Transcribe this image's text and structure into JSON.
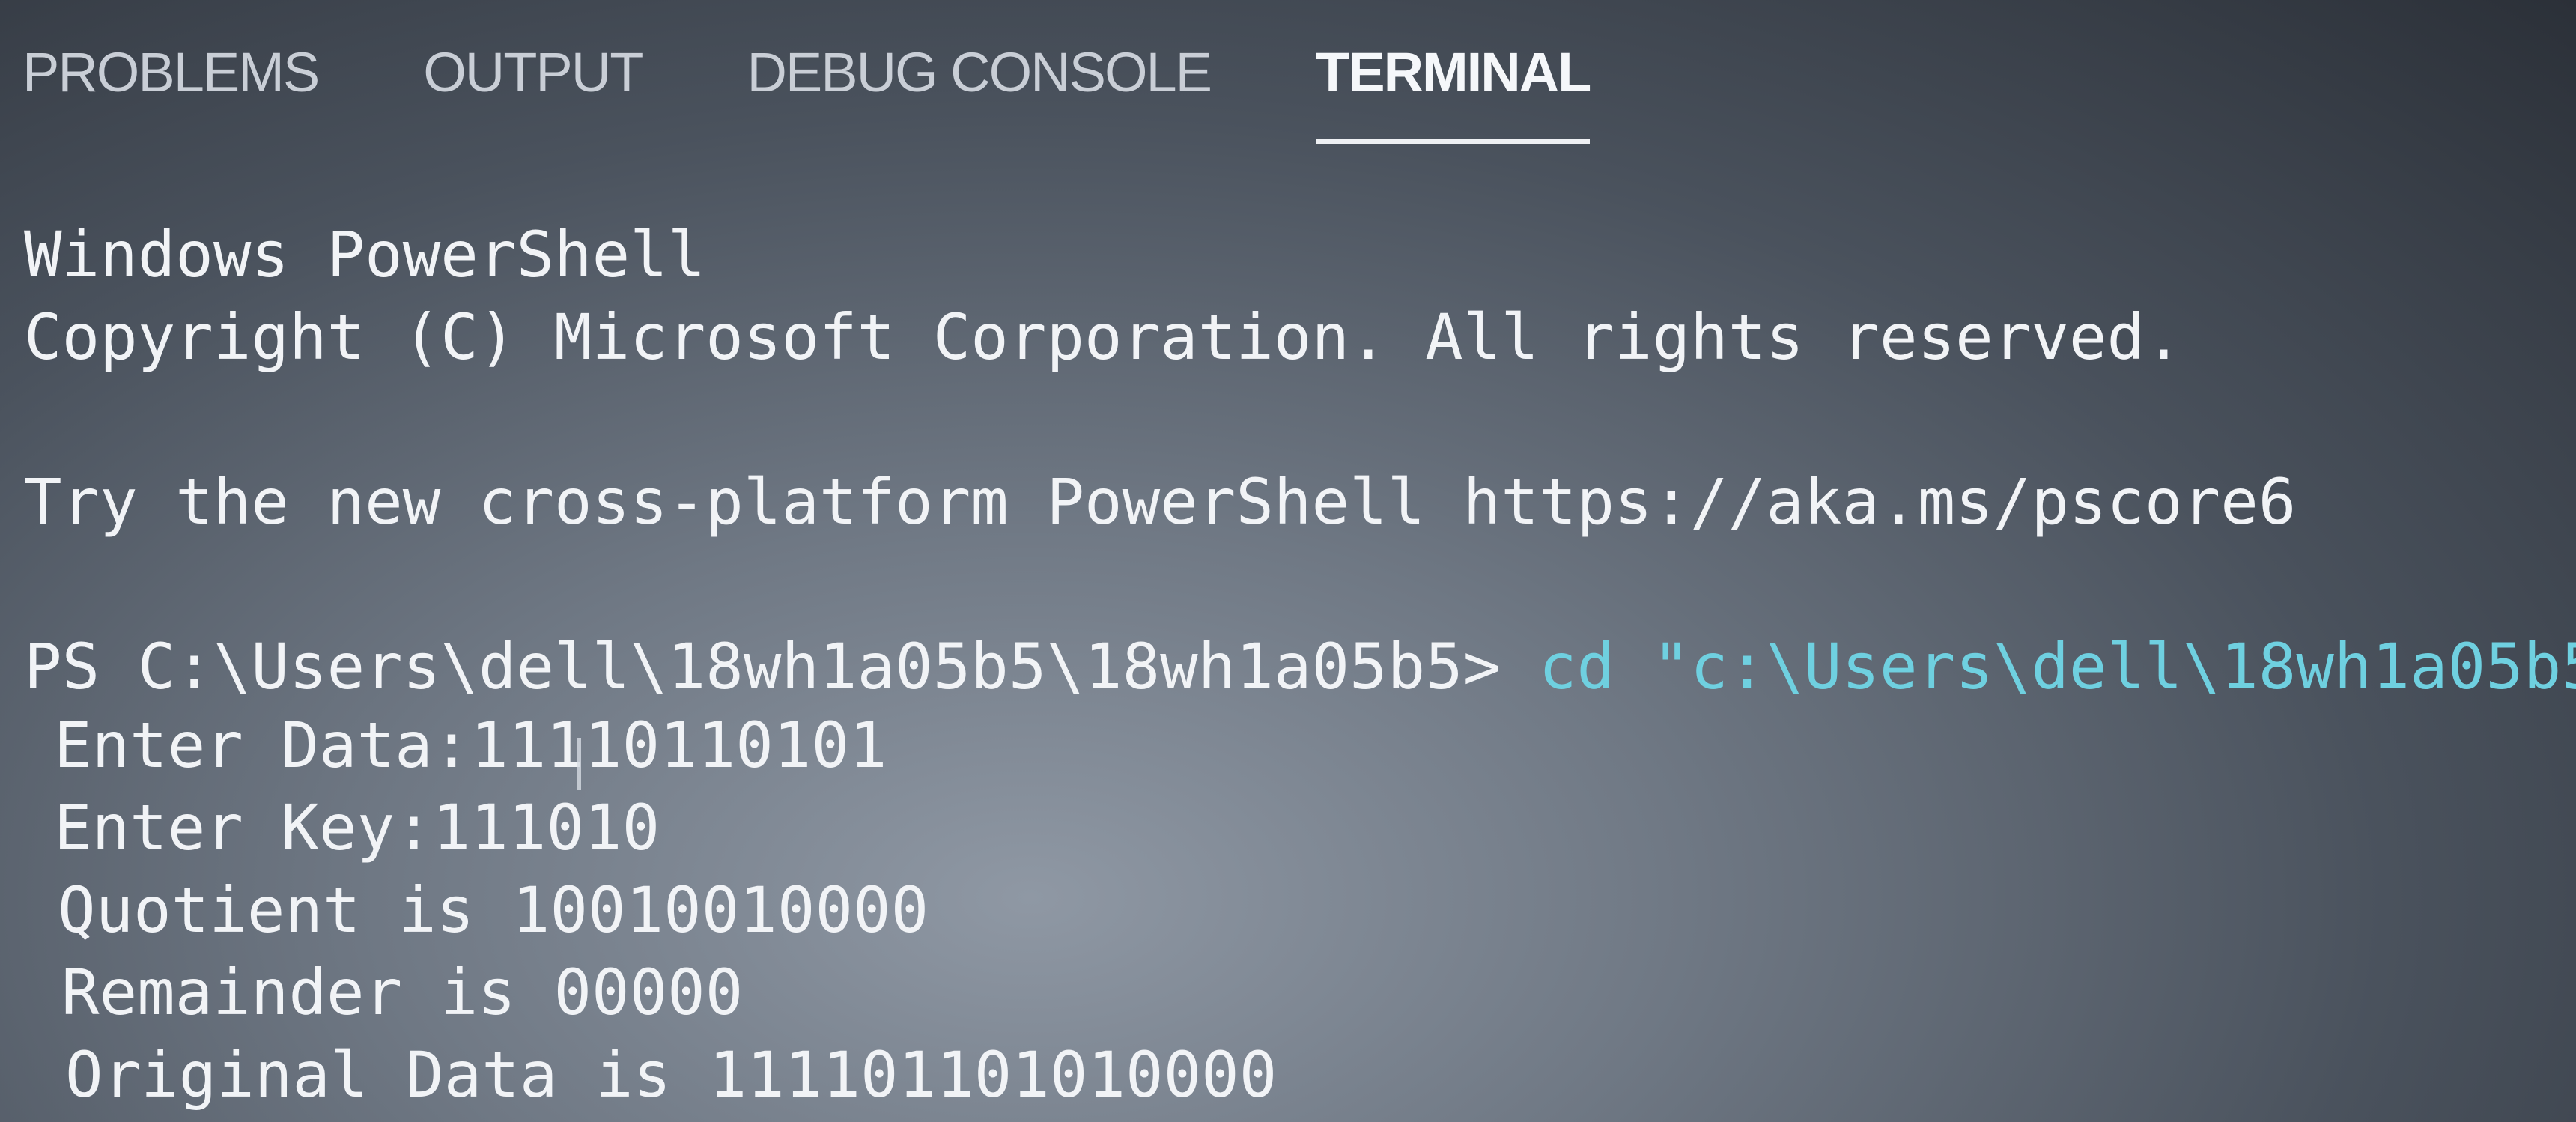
{
  "panel": {
    "tabs": [
      {
        "label": "PROBLEMS",
        "active": false
      },
      {
        "label": "OUTPUT",
        "active": false
      },
      {
        "label": "DEBUG CONSOLE",
        "active": false
      },
      {
        "label": "TERMINAL",
        "active": true
      }
    ]
  },
  "terminal": {
    "banner_title": "Windows PowerShell",
    "banner_copyright": "Copyright (C) Microsoft Corporation. All rights reserved.",
    "banner_tip": "Try the new cross-platform PowerShell https://aka.ms/pscore6",
    "prompt": "PS C:\\Users\\dell\\18wh1a05b5\\18wh1a05b5>",
    "command": " cd \"c:\\Users\\dell\\18wh1a05b5",
    "output": [
      "Enter Data:11110110101",
      "Enter Key:111010",
      "Quotient is 10010010000",
      "Remainder is 00000",
      "Original Data is 111101101010000"
    ]
  },
  "colors": {
    "command_text": "#6fd0e0",
    "text": "#f1f3f6",
    "active_tab_underline": "#eef0f3"
  }
}
